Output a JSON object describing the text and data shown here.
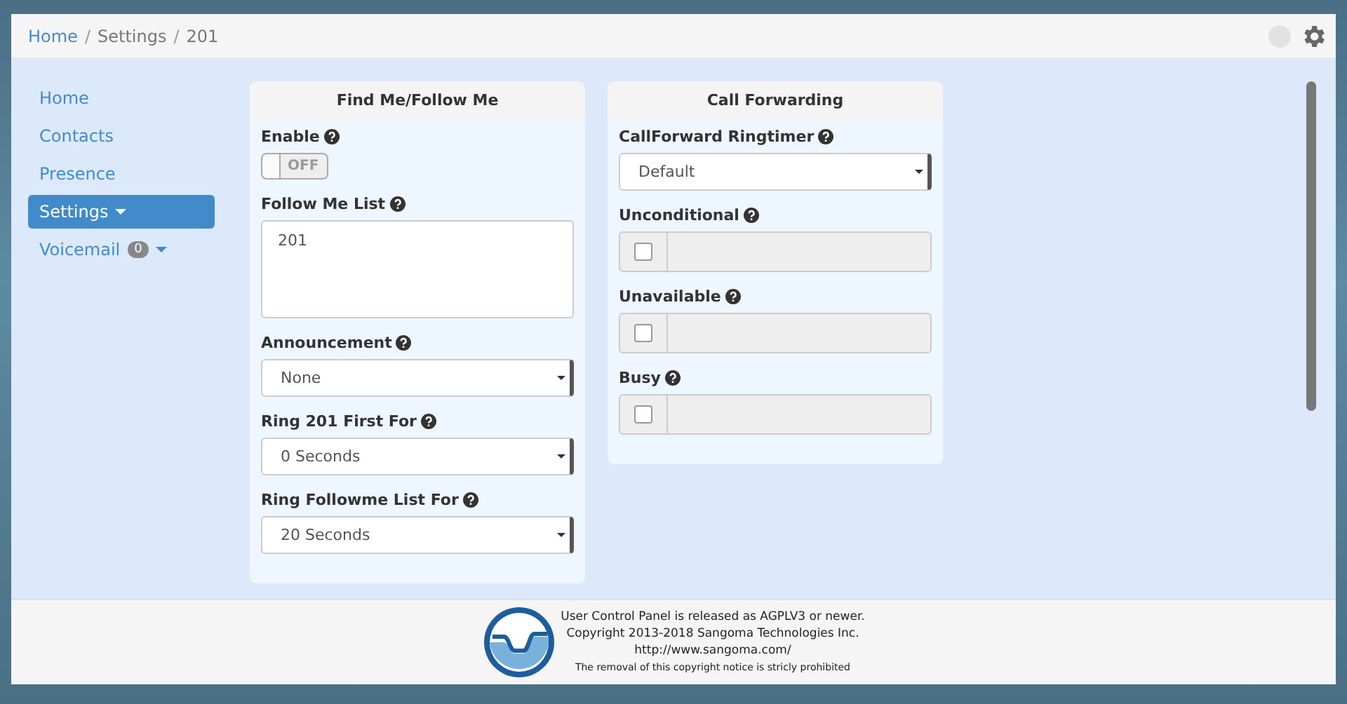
{
  "breadcrumb_separator": "/",
  "breadcrumb": [
    {
      "label": "Home",
      "link": true
    },
    {
      "label": "Settings",
      "link": false
    },
    {
      "label": "201",
      "link": false
    }
  ],
  "sidebar": {
    "items": [
      {
        "label": "Home",
        "selected": false,
        "caret": false
      },
      {
        "label": "Contacts",
        "selected": false,
        "caret": false
      },
      {
        "label": "Presence",
        "selected": false,
        "caret": false
      },
      {
        "label": "Settings",
        "selected": true,
        "caret": true
      },
      {
        "label": "Voicemail",
        "selected": false,
        "caret": true,
        "badge": "0"
      }
    ]
  },
  "panels": [
    {
      "title": "Find Me/Follow Me",
      "fields": [
        {
          "kind": "toggle",
          "label": "Enable",
          "on": false,
          "text": "OFF"
        },
        {
          "kind": "textarea",
          "label": "Follow Me List",
          "value": "201"
        },
        {
          "kind": "select",
          "label": "Announcement",
          "value": "None"
        },
        {
          "kind": "select",
          "label": "Ring 201 First For",
          "value": "0 Seconds"
        },
        {
          "kind": "select",
          "label": "Ring Followme List For",
          "value": "20 Seconds"
        }
      ]
    },
    {
      "title": "Call Forwarding",
      "fields": [
        {
          "kind": "select",
          "label": "CallForward Ringtimer",
          "value": "Default"
        },
        {
          "kind": "checkinput",
          "label": "Unconditional",
          "checked": false
        },
        {
          "kind": "checkinput",
          "label": "Unavailable",
          "checked": false
        },
        {
          "kind": "checkinput",
          "label": "Busy",
          "checked": false
        }
      ]
    }
  ],
  "footer": {
    "lines": [
      "User Control Panel is released as AGPLV3 or newer.",
      "Copyright 2013-2018 Sangoma Technologies Inc.",
      "http://www.sangoma.com/",
      "The removal of this copyright notice is stricly prohibited"
    ]
  }
}
